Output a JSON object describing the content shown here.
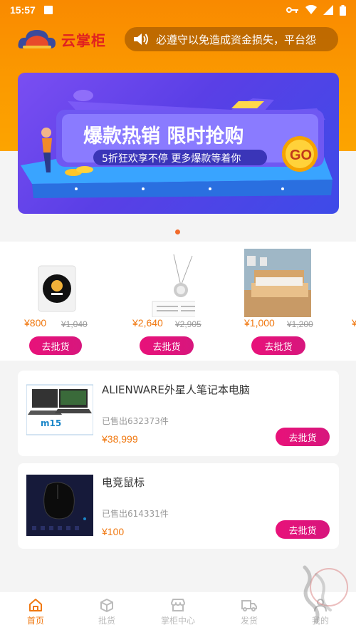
{
  "status_bar": {
    "time": "15:57"
  },
  "header": {
    "app_name": "云掌柜",
    "notice": "必遵守以免造成资金损失，平台怨"
  },
  "banner": {
    "headline": "爆款热销 限时抢购",
    "subline": "5折狂欢享不停  更多爆款等着你",
    "go_label": "GO"
  },
  "featured": [
    {
      "price": "¥800",
      "original_price": "¥1,040",
      "button": "去批货"
    },
    {
      "price": "¥2,640",
      "original_price": "¥2,905",
      "button": "去批货"
    },
    {
      "price": "¥1,000",
      "original_price": "¥1,200",
      "button": "去批货"
    }
  ],
  "products": [
    {
      "title": "ALIENWARE外星人笔记本电脑",
      "sold": "已售出632373件",
      "price": "¥38,999",
      "button": "去批货"
    },
    {
      "title": "电竞鼠标",
      "sold": "已售出614331件",
      "price": "¥100",
      "button": "去批货"
    }
  ],
  "tabbar": [
    {
      "label": "首页",
      "icon": "home-icon",
      "active": true
    },
    {
      "label": "批货",
      "icon": "box-icon",
      "active": false
    },
    {
      "label": "掌柜中心",
      "icon": "store-icon",
      "active": false
    },
    {
      "label": "发货",
      "icon": "truck-icon",
      "active": false
    },
    {
      "label": "我的",
      "icon": "user-icon",
      "active": false
    }
  ],
  "colors": {
    "accent": "#f07810",
    "button": "#e8127a",
    "header": "#fb9a00"
  }
}
